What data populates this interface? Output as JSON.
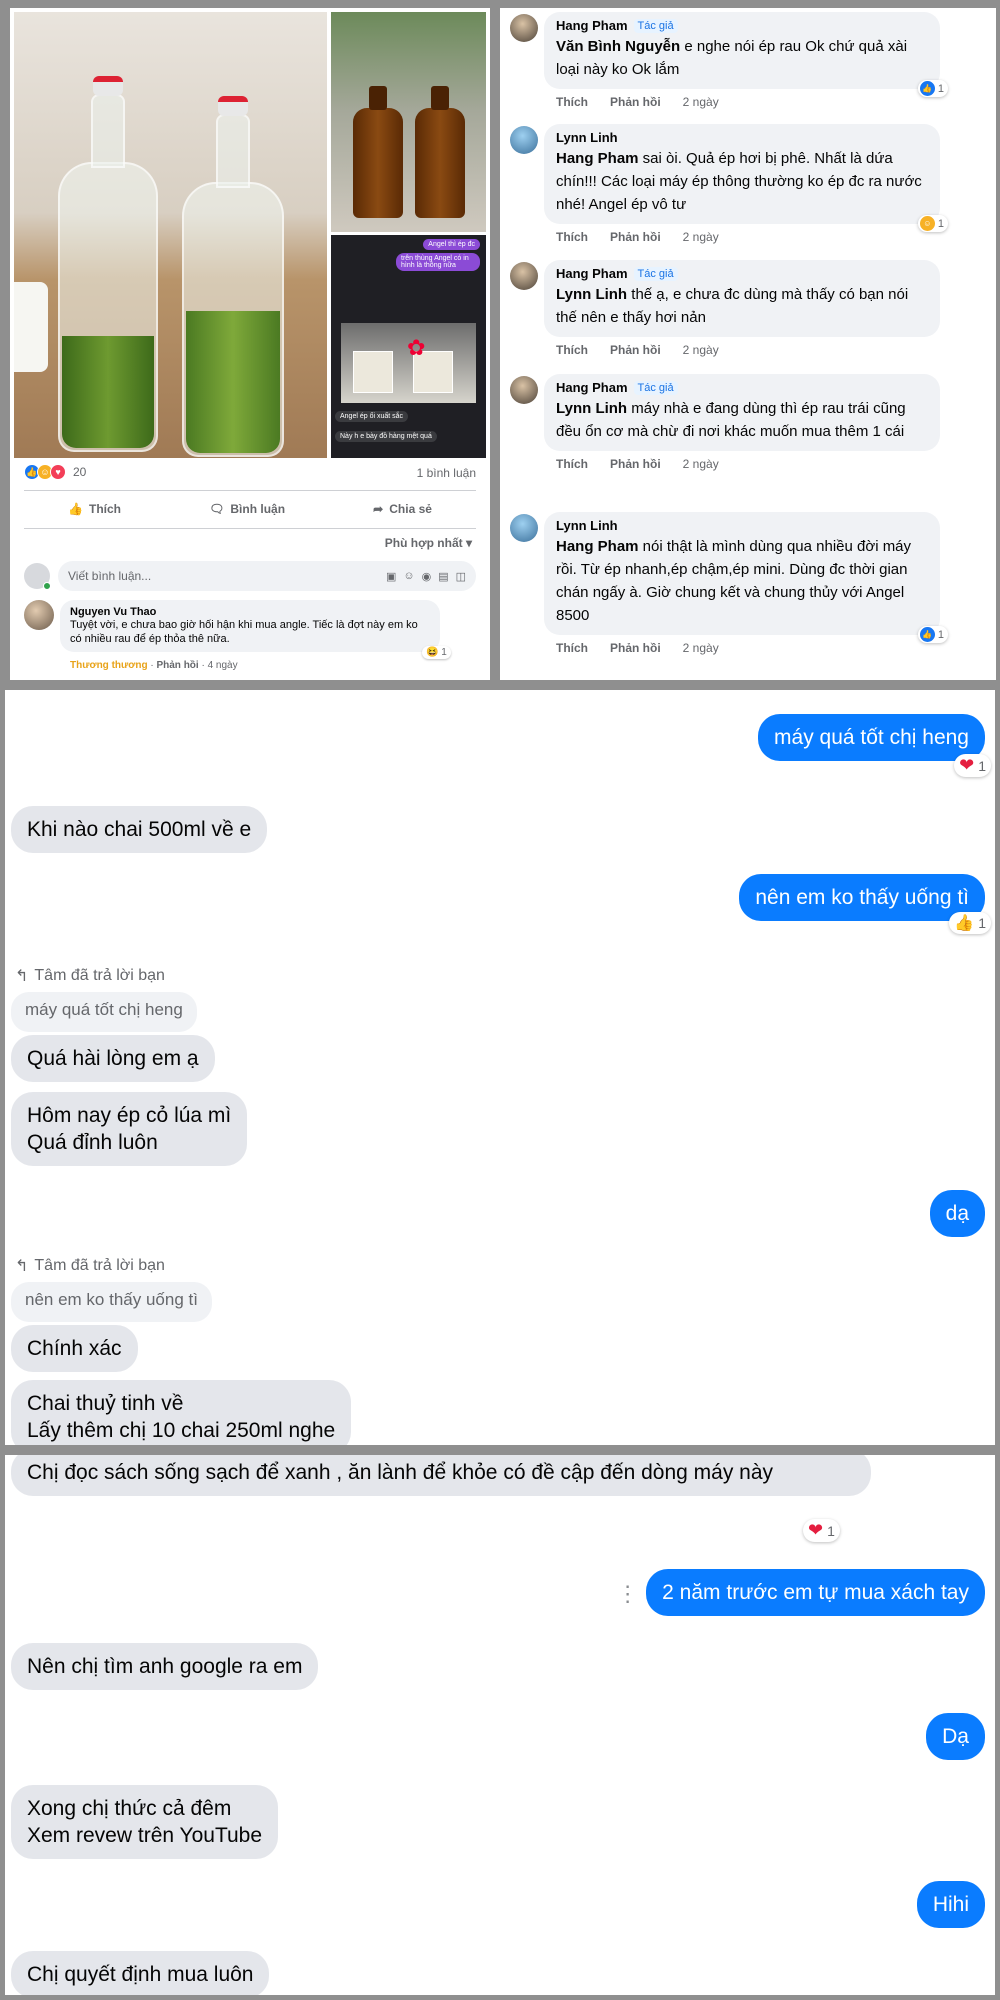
{
  "post": {
    "chat_preview": {
      "bubble1": "Angel thì ép đc",
      "bubble2": "trên thùng Angel có in hình là thông nữa",
      "bubble3": "Angel ép ổi xuất sắc",
      "bubble4": "Này h e bày đồ hàng mệt quá"
    },
    "reaction_count": "20",
    "comment_count": "1 bình luận",
    "actions": {
      "like": "Thích",
      "comment": "Bình luận",
      "share": "Chia sẻ"
    },
    "sort_label": "Phù hợp nhất",
    "write_placeholder": "Viết bình luận...",
    "comment": {
      "name": "Nguyen Vu Thao",
      "text": "Tuyệt vời, e chưa bao giờ hối hận khi mua angle. Tiếc là đợt này em ko có nhiều rau để ép thỏa thê nữa.",
      "author_tag": "Thương thương",
      "reply": "Phản hồi",
      "time": "4 ngày",
      "reaction_count": "1"
    }
  },
  "thread": {
    "author_badge": "Tác giả",
    "like": "Thích",
    "reply": "Phản hồi",
    "comments": [
      {
        "name": "Hang Pham",
        "tag": "Văn Bình Nguyễn",
        "text": " e nghe nói ép rau Ok chứ quả xài loại này ko Ok lắm",
        "time": "2 ngày",
        "reactions": "1"
      },
      {
        "name": "Lynn Linh",
        "tag": "Hang Pham",
        "text": " sai òi. Quả ép hơi bị phê. Nhất là dứa chín!!! Các loại máy ép thông thường ko ép đc ra nước nhé! Angel ép vô tư",
        "time": "2 ngày",
        "reactions": "1"
      },
      {
        "name": "Hang Pham",
        "tag": "Lynn Linh",
        "text": " thế ạ, e chưa đc dùng mà thấy có bạn nói thế nên e thấy hơi nản",
        "time": "2 ngày",
        "reactions": ""
      },
      {
        "name": "Hang Pham",
        "tag": "Lynn Linh",
        "text": " máy nhà e đang dùng thì ép rau trái cũng đều ổn cơ mà chừ đi nơi khác muốn mua thêm 1 cái",
        "time": "2 ngày",
        "reactions": ""
      },
      {
        "name": "Lynn Linh",
        "tag": "Hang Pham",
        "text": " nói thật là mình dùng qua nhiều đời máy rồi. Từ ép nhanh,ép chậm,ép mini. Dùng đc thời gian chán ngấy à. Giờ chung kết và chung thủy với Angel 8500",
        "time": "2 ngày",
        "reactions": "1"
      }
    ]
  },
  "chat1": {
    "m1": "máy quá tốt chị heng",
    "m1_react": "1",
    "m2": "Khi nào chai 500ml về e",
    "m3": "nên em ko thấy uống tì",
    "m3_react": "1",
    "reply_note": "Tâm đã trả lời bạn",
    "q1": "máy quá tốt chị heng",
    "m4": "Quá hài lòng em ạ",
    "m5a": "Hôm nay ép cỏ lúa mì",
    "m5b": "Quá đỉnh luôn",
    "m6": "dạ",
    "reply_note2": "Tâm đã trả lời bạn",
    "q2": "nên em ko thấy uống tì",
    "m7": "Chính xác",
    "m8a": "Chai thuỷ tinh về",
    "m8b": "Lấy thêm chị 10 chai 250ml nghe"
  },
  "chat2": {
    "m1": "Chị đọc sách sống sạch để xanh , ăn lành để khỏe có đề cập đến dòng máy này",
    "m1_react": "1",
    "m2": "2 năm trước em tự mua xách tay",
    "m3": "Nên chị tìm anh google ra em",
    "m4": "Dạ",
    "m5a": "Xong chị thức cả đêm",
    "m5b": "Xem revew trên YouTube",
    "m6": "Hihi",
    "m7": "Chị quyết định mua luôn"
  }
}
